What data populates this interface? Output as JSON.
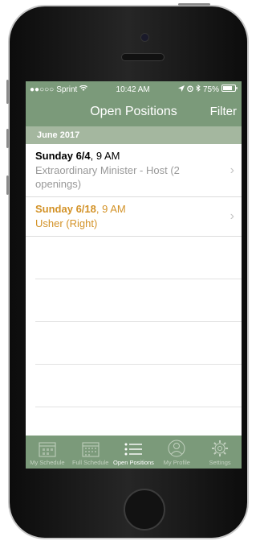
{
  "status_bar": {
    "carrier": "Sprint",
    "signal": "●●○○○",
    "time": "10:42 AM",
    "battery": "75%"
  },
  "nav": {
    "title": "Open Positions",
    "filter_label": "Filter"
  },
  "section": {
    "header": "June 2017"
  },
  "positions": [
    {
      "date": "Sunday 6/4",
      "time": ", 9 AM",
      "role": "Extraordinary Minister - Host (2 openings)",
      "highlight": false
    },
    {
      "date": "Sunday 6/18",
      "time": ", 9 AM",
      "role": "Usher (Right)",
      "highlight": true
    }
  ],
  "tabs": [
    {
      "label": "My Schedule",
      "icon": "calendar-icon"
    },
    {
      "label": "Full Schedule",
      "icon": "calendar-grid-icon"
    },
    {
      "label": "Open Positions",
      "icon": "list-icon"
    },
    {
      "label": "My Profile",
      "icon": "person-icon"
    },
    {
      "label": "Settings",
      "icon": "gear-icon"
    }
  ],
  "colors": {
    "bar_green": "#7b9a7a",
    "section_green": "#a4b79f",
    "highlight_orange": "#d39227"
  }
}
